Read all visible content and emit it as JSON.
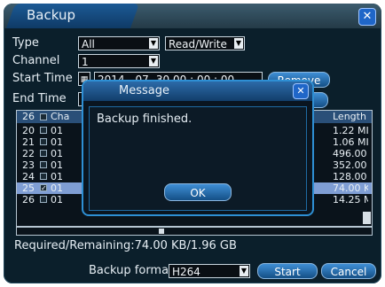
{
  "window": {
    "title": "Backup"
  },
  "form": {
    "type_label": "Type",
    "type_value": "All",
    "mode_value": "Read/Write",
    "channel_label": "Channel",
    "channel_value": "1",
    "start_label": "Start Time",
    "start_value": "2014 - 07- 30   00 : 00 : 00",
    "end_label": "End Time",
    "remove_label": "Remove"
  },
  "table": {
    "headers": {
      "num": "26",
      "channel": "Cha",
      "length": "Length"
    },
    "rows": [
      {
        "num": "20",
        "ch": "01",
        "checked": false,
        "length": "1.22 MI",
        "selected": false
      },
      {
        "num": "21",
        "ch": "01",
        "checked": false,
        "length": "1.06 MI",
        "selected": false
      },
      {
        "num": "22",
        "ch": "01",
        "checked": false,
        "length": "496.00",
        "selected": false
      },
      {
        "num": "23",
        "ch": "01",
        "checked": false,
        "length": "352.00",
        "selected": false
      },
      {
        "num": "24",
        "ch": "01",
        "checked": false,
        "length": "128.00",
        "selected": false
      },
      {
        "num": "25",
        "ch": "01",
        "checked": true,
        "length": "74.00 K",
        "selected": true
      },
      {
        "num": "26",
        "ch": "01",
        "checked": false,
        "length": "14.25 M",
        "selected": false
      }
    ]
  },
  "status": {
    "required_remaining": "Required/Remaining:74.00 KB/1.96 GB"
  },
  "footer": {
    "format_label": "Backup format",
    "format_value": "H264",
    "start_label": "Start",
    "cancel_label": "Cancel"
  },
  "message": {
    "title": "Message",
    "text": "Backup finished.",
    "ok_label": "OK"
  }
}
